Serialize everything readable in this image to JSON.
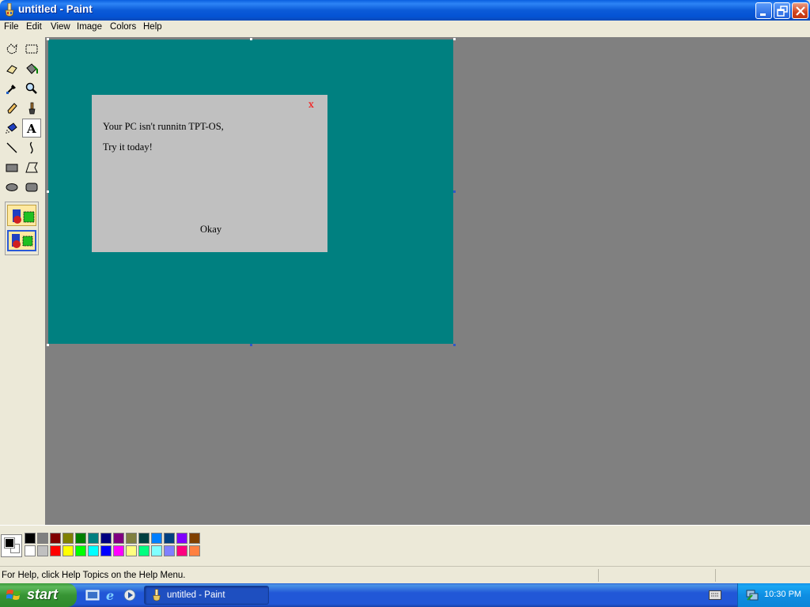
{
  "window": {
    "title": "untitled - Paint"
  },
  "menubar": {
    "items": [
      "File",
      "Edit",
      "View",
      "Image",
      "Colors",
      "Help"
    ]
  },
  "toolbox": {
    "tools": [
      "free-form-select",
      "select",
      "eraser",
      "fill-with-color",
      "pick-color",
      "magnifier",
      "pencil",
      "brush",
      "airbrush",
      "text",
      "line",
      "curve",
      "rectangle",
      "polygon",
      "ellipse",
      "rounded-rectangle"
    ],
    "active_tool": "text"
  },
  "canvas": {
    "background": "#008080",
    "dialog": {
      "close_label": "x",
      "line1": "Your PC isn't runnitn TPT-OS,",
      "line2": "Try it today!",
      "button_label": "Okay"
    }
  },
  "palette": {
    "foreground": "#000000",
    "background": "#ffffff",
    "row1": [
      "#000000",
      "#808080",
      "#800000",
      "#808000",
      "#008000",
      "#008080",
      "#000080",
      "#800080",
      "#808040",
      "#004040",
      "#0080ff",
      "#004080",
      "#8000ff",
      "#804000"
    ],
    "row2": [
      "#ffffff",
      "#c0c0c0",
      "#ff0000",
      "#ffff00",
      "#00ff00",
      "#00ffff",
      "#0000ff",
      "#ff00ff",
      "#ffff80",
      "#00ff80",
      "#80ffff",
      "#8080ff",
      "#ff0080",
      "#ff8040"
    ]
  },
  "statusbar": {
    "text": "For Help, click Help Topics on the Help Menu."
  },
  "taskbar": {
    "start_label": "start",
    "task_label": "untitled - Paint",
    "clock": "10:30 PM"
  }
}
